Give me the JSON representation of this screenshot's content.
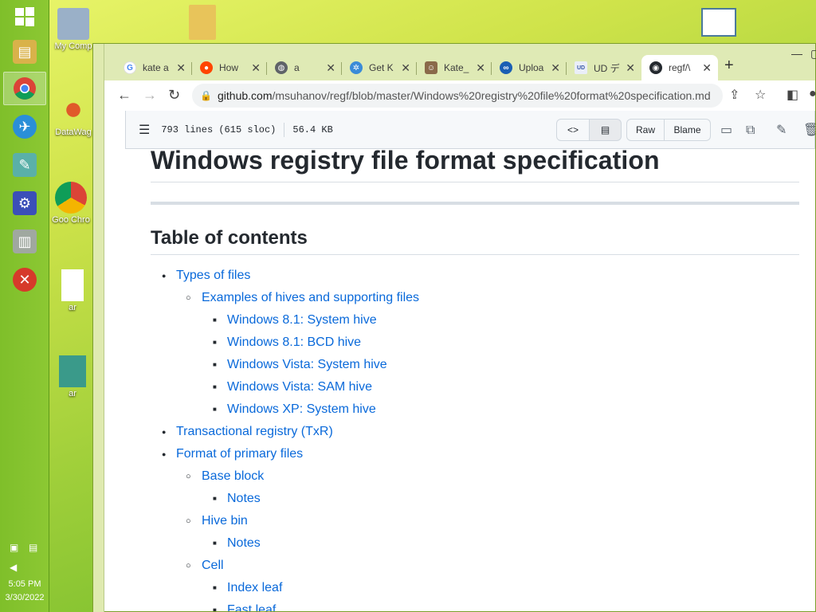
{
  "taskbar": {
    "apps": [
      {
        "name": "file-manager-icon"
      },
      {
        "name": "chrome-icon",
        "active": true
      },
      {
        "name": "airplane-app-icon"
      },
      {
        "name": "notepad-icon"
      },
      {
        "name": "settings-icon"
      },
      {
        "name": "archive-icon"
      },
      {
        "name": "close-app-icon"
      }
    ],
    "clock": {
      "time": "5:05 PM",
      "date": "3/30/2022"
    }
  },
  "desktop": {
    "icons": [
      {
        "label": "My Comp"
      },
      {
        "label": "DataWag"
      },
      {
        "label": "Goo Chro"
      },
      {
        "label": "ar"
      },
      {
        "label": "ar"
      }
    ]
  },
  "browser": {
    "tabs": [
      {
        "label": "kate a",
        "icon": "google-icon",
        "color": "#4285f4"
      },
      {
        "label": "How",
        "icon": "reddit-icon",
        "color": "#ff4500"
      },
      {
        "label": "a",
        "icon": "globe-icon",
        "color": "#5f6368"
      },
      {
        "label": "Get K",
        "icon": "settings-gear-favicon",
        "color": "#3a8bd8"
      },
      {
        "label": "Kate_",
        "icon": "avatar-favicon",
        "color": "#8a6a4a"
      },
      {
        "label": "Uploa",
        "icon": "upload-favicon",
        "color": "#1a5fb4"
      },
      {
        "label": "UD デ",
        "icon": "ud-favicon",
        "color": "#7aa0d8"
      },
      {
        "label": "regf/\\",
        "icon": "github-icon",
        "color": "#24292f",
        "active": true
      }
    ],
    "new_tab": "+",
    "url_host": "github.com",
    "url_path": "/msuhanov/regf/blob/master/Windows%20registry%20file%20format%20specification.md"
  },
  "file_header": {
    "lines": "793 lines (615 sloc)",
    "size": "56.4 KB",
    "raw_label": "Raw",
    "blame_label": "Blame"
  },
  "content": {
    "title": "Windows registry file format specification",
    "toc_heading": "Table of contents",
    "toc": [
      {
        "level": 1,
        "text": "Types of files"
      },
      {
        "level": 2,
        "text": "Examples of hives and supporting files"
      },
      {
        "level": 3,
        "text": "Windows 8.1: System hive"
      },
      {
        "level": 3,
        "text": "Windows 8.1: BCD hive"
      },
      {
        "level": 3,
        "text": "Windows Vista: System hive"
      },
      {
        "level": 3,
        "text": "Windows Vista: SAM hive"
      },
      {
        "level": 3,
        "text": "Windows XP: System hive"
      },
      {
        "level": 1,
        "text": "Transactional registry (TxR)"
      },
      {
        "level": 1,
        "text": "Format of primary files"
      },
      {
        "level": 2,
        "text": "Base block"
      },
      {
        "level": 3,
        "text": "Notes"
      },
      {
        "level": 2,
        "text": "Hive bin"
      },
      {
        "level": 3,
        "text": "Notes"
      },
      {
        "level": 2,
        "text": "Cell"
      },
      {
        "level": 3,
        "text": "Index leaf"
      },
      {
        "level": 3,
        "text": "Fast leaf"
      }
    ]
  }
}
